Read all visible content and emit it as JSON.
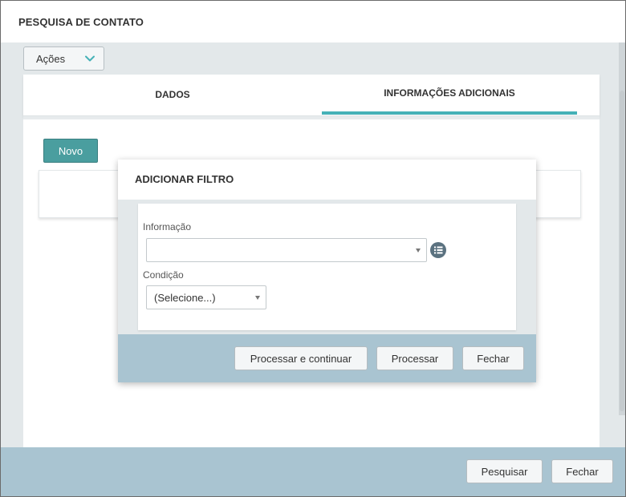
{
  "window": {
    "title": "PESQUISA DE CONTATO"
  },
  "actions": {
    "label": "Ações",
    "icon": "chevron-down-icon",
    "accent": "#45b1b7"
  },
  "tabs": [
    {
      "label": "DADOS"
    },
    {
      "label": "INFORMAÇÕES ADICIONAIS",
      "active": true
    }
  ],
  "content": {
    "new_button": "Novo",
    "new_button_color": "#4a9e9f"
  },
  "footer": {
    "search_label": "Pesquisar",
    "close_label": "Fechar"
  },
  "dialog": {
    "title": "ADICIONAR FILTRO",
    "information": {
      "label": "Informação",
      "value": ""
    },
    "list_icon": "list-icon",
    "condition": {
      "label": "Condição",
      "value": "(Selecione...)"
    },
    "buttons": {
      "process_continue": "Processar e continuar",
      "process": "Processar",
      "close": "Fechar"
    }
  }
}
